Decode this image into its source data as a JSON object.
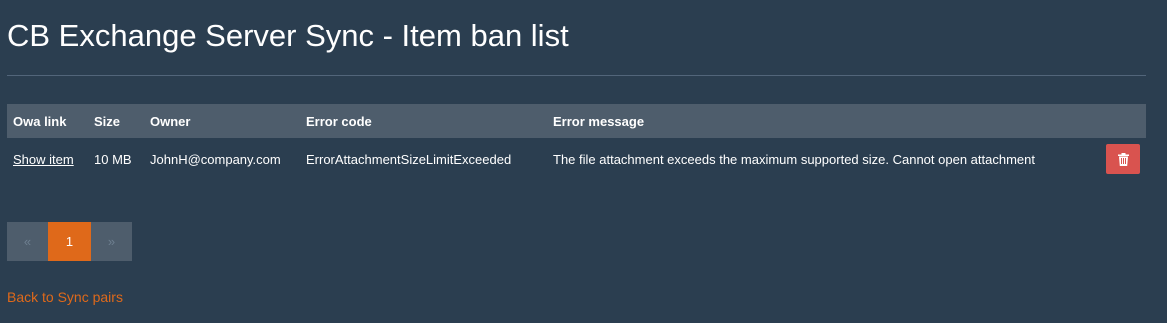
{
  "page": {
    "title": "CB Exchange Server Sync - Item ban list"
  },
  "table": {
    "headers": {
      "owa_link": "Owa link",
      "size": "Size",
      "owner": "Owner",
      "error_code": "Error code",
      "error_message": "Error message"
    },
    "rows": [
      {
        "owa_link": "Show item",
        "size": "10 MB",
        "owner": "JohnH@company.com",
        "error_code": "ErrorAttachmentSizeLimitExceeded",
        "error_message": "The file attachment exceeds the maximum supported size. Cannot open attachment",
        "delete_icon": "trash-icon"
      }
    ]
  },
  "pagination": {
    "prev": "«",
    "current": "1",
    "next": "»"
  },
  "footer": {
    "back_link": "Back to Sync pairs"
  },
  "colors": {
    "background": "#2b3e50",
    "accent": "#df691a",
    "danger": "#d9534f",
    "header_bg": "#4e5d6c"
  }
}
